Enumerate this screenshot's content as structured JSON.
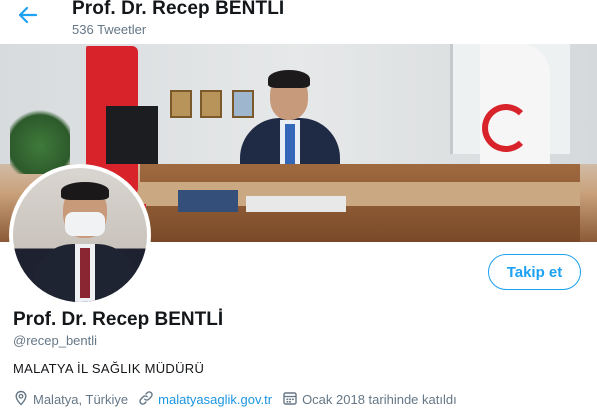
{
  "header": {
    "back_icon": "arrow-left-icon",
    "title": "Prof. Dr. Recep BENTLİ",
    "tweet_count": "536 Tweetler"
  },
  "profile": {
    "name": "Prof. Dr. Recep BENTLİ",
    "handle": "@recep_bentli",
    "bio": "MALATYA İL SAĞLIK MÜDÜRÜ",
    "location": "Malatya, Türkiye",
    "website": "malatyasaglik.gov.tr",
    "joined": "Ocak 2018 tarihinde katıldı",
    "follow_label": "Takip et"
  },
  "icons": {
    "location": "location-pin-icon",
    "website": "link-icon",
    "joined": "calendar-icon"
  },
  "colors": {
    "accent": "#1da1f2",
    "secondary_text": "#657786",
    "link": "#1b95e0"
  }
}
